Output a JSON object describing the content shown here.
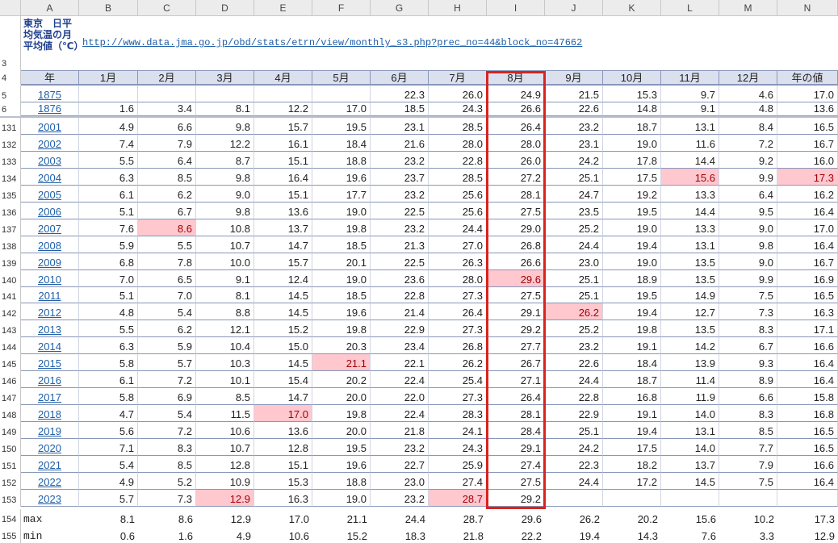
{
  "columns": [
    "A",
    "B",
    "C",
    "D",
    "E",
    "F",
    "G",
    "H",
    "I",
    "J",
    "K",
    "L",
    "M",
    "N"
  ],
  "title_cell": "東京　日平均気温の月平均値（℃）",
  "url": "http://www.data.jma.go.jp/obd/stats/etrn/view/monthly_s3.php?prec_no=44&block_no=47662",
  "header_row": [
    "年",
    "1月",
    "2月",
    "3月",
    "4月",
    "5月",
    "6月",
    "7月",
    "8月",
    "9月",
    "10月",
    "11月",
    "12月",
    "年の値"
  ],
  "top_rows": [
    {
      "row": "5",
      "year": "1875",
      "values": [
        "",
        "",
        "",
        "",
        "",
        "22.3",
        "26.0",
        "24.9",
        "21.5",
        "15.3",
        "9.7",
        "4.6",
        "17.0"
      ]
    },
    {
      "row": "6",
      "year": "1876",
      "values": [
        "1.6",
        "3.4",
        "8.1",
        "12.2",
        "17.0",
        "18.5",
        "24.3",
        "26.6",
        "22.6",
        "14.8",
        "9.1",
        "4.8",
        "13.6"
      ]
    }
  ],
  "rows": [
    {
      "row": "131",
      "year": "2001",
      "values": [
        "4.9",
        "6.6",
        "9.8",
        "15.7",
        "19.5",
        "23.1",
        "28.5",
        "26.4",
        "23.2",
        "18.7",
        "13.1",
        "8.4",
        "16.5"
      ]
    },
    {
      "row": "132",
      "year": "2002",
      "values": [
        "7.4",
        "7.9",
        "12.2",
        "16.1",
        "18.4",
        "21.6",
        "28.0",
        "28.0",
        "23.1",
        "19.0",
        "11.6",
        "7.2",
        "16.7"
      ]
    },
    {
      "row": "133",
      "year": "2003",
      "values": [
        "5.5",
        "6.4",
        "8.7",
        "15.1",
        "18.8",
        "23.2",
        "22.8",
        "26.0",
        "24.2",
        "17.8",
        "14.4",
        "9.2",
        "16.0"
      ]
    },
    {
      "row": "134",
      "year": "2004",
      "values": [
        "6.3",
        "8.5",
        "9.8",
        "16.4",
        "19.6",
        "23.7",
        "28.5",
        "27.2",
        "25.1",
        "17.5",
        "15.6",
        "9.9",
        "17.3"
      ]
    },
    {
      "row": "135",
      "year": "2005",
      "values": [
        "6.1",
        "6.2",
        "9.0",
        "15.1",
        "17.7",
        "23.2",
        "25.6",
        "28.1",
        "24.7",
        "19.2",
        "13.3",
        "6.4",
        "16.2"
      ]
    },
    {
      "row": "136",
      "year": "2006",
      "values": [
        "5.1",
        "6.7",
        "9.8",
        "13.6",
        "19.0",
        "22.5",
        "25.6",
        "27.5",
        "23.5",
        "19.5",
        "14.4",
        "9.5",
        "16.4"
      ]
    },
    {
      "row": "137",
      "year": "2007",
      "values": [
        "7.6",
        "8.6",
        "10.8",
        "13.7",
        "19.8",
        "23.2",
        "24.4",
        "29.0",
        "25.2",
        "19.0",
        "13.3",
        "9.0",
        "17.0"
      ]
    },
    {
      "row": "138",
      "year": "2008",
      "values": [
        "5.9",
        "5.5",
        "10.7",
        "14.7",
        "18.5",
        "21.3",
        "27.0",
        "26.8",
        "24.4",
        "19.4",
        "13.1",
        "9.8",
        "16.4"
      ]
    },
    {
      "row": "139",
      "year": "2009",
      "values": [
        "6.8",
        "7.8",
        "10.0",
        "15.7",
        "20.1",
        "22.5",
        "26.3",
        "26.6",
        "23.0",
        "19.0",
        "13.5",
        "9.0",
        "16.7"
      ]
    },
    {
      "row": "140",
      "year": "2010",
      "values": [
        "7.0",
        "6.5",
        "9.1",
        "12.4",
        "19.0",
        "23.6",
        "28.0",
        "29.6",
        "25.1",
        "18.9",
        "13.5",
        "9.9",
        "16.9"
      ]
    },
    {
      "row": "141",
      "year": "2011",
      "values": [
        "5.1",
        "7.0",
        "8.1",
        "14.5",
        "18.5",
        "22.8",
        "27.3",
        "27.5",
        "25.1",
        "19.5",
        "14.9",
        "7.5",
        "16.5"
      ]
    },
    {
      "row": "142",
      "year": "2012",
      "values": [
        "4.8",
        "5.4",
        "8.8",
        "14.5",
        "19.6",
        "21.4",
        "26.4",
        "29.1",
        "26.2",
        "19.4",
        "12.7",
        "7.3",
        "16.3"
      ]
    },
    {
      "row": "143",
      "year": "2013",
      "values": [
        "5.5",
        "6.2",
        "12.1",
        "15.2",
        "19.8",
        "22.9",
        "27.3",
        "29.2",
        "25.2",
        "19.8",
        "13.5",
        "8.3",
        "17.1"
      ]
    },
    {
      "row": "144",
      "year": "2014",
      "values": [
        "6.3",
        "5.9",
        "10.4",
        "15.0",
        "20.3",
        "23.4",
        "26.8",
        "27.7",
        "23.2",
        "19.1",
        "14.2",
        "6.7",
        "16.6"
      ]
    },
    {
      "row": "145",
      "year": "2015",
      "values": [
        "5.8",
        "5.7",
        "10.3",
        "14.5",
        "21.1",
        "22.1",
        "26.2",
        "26.7",
        "22.6",
        "18.4",
        "13.9",
        "9.3",
        "16.4"
      ]
    },
    {
      "row": "146",
      "year": "2016",
      "values": [
        "6.1",
        "7.2",
        "10.1",
        "15.4",
        "20.2",
        "22.4",
        "25.4",
        "27.1",
        "24.4",
        "18.7",
        "11.4",
        "8.9",
        "16.4"
      ]
    },
    {
      "row": "147",
      "year": "2017",
      "values": [
        "5.8",
        "6.9",
        "8.5",
        "14.7",
        "20.0",
        "22.0",
        "27.3",
        "26.4",
        "22.8",
        "16.8",
        "11.9",
        "6.6",
        "15.8"
      ]
    },
    {
      "row": "148",
      "year": "2018",
      "values": [
        "4.7",
        "5.4",
        "11.5",
        "17.0",
        "19.8",
        "22.4",
        "28.3",
        "28.1",
        "22.9",
        "19.1",
        "14.0",
        "8.3",
        "16.8"
      ]
    },
    {
      "row": "149",
      "year": "2019",
      "values": [
        "5.6",
        "7.2",
        "10.6",
        "13.6",
        "20.0",
        "21.8",
        "24.1",
        "28.4",
        "25.1",
        "19.4",
        "13.1",
        "8.5",
        "16.5"
      ]
    },
    {
      "row": "150",
      "year": "2020",
      "values": [
        "7.1",
        "8.3",
        "10.7",
        "12.8",
        "19.5",
        "23.2",
        "24.3",
        "29.1",
        "24.2",
        "17.5",
        "14.0",
        "7.7",
        "16.5"
      ]
    },
    {
      "row": "151",
      "year": "2021",
      "values": [
        "5.4",
        "8.5",
        "12.8",
        "15.1",
        "19.6",
        "22.7",
        "25.9",
        "27.4",
        "22.3",
        "18.2",
        "13.7",
        "7.9",
        "16.6"
      ]
    },
    {
      "row": "152",
      "year": "2022",
      "values": [
        "4.9",
        "5.2",
        "10.9",
        "15.3",
        "18.8",
        "23.0",
        "27.4",
        "27.5",
        "24.4",
        "17.2",
        "14.5",
        "7.5",
        "16.4"
      ]
    },
    {
      "row": "153",
      "year": "2023",
      "values": [
        "5.7",
        "7.3",
        "12.9",
        "16.3",
        "19.0",
        "23.2",
        "28.7",
        "29.2",
        "",
        "",
        "",
        "",
        ""
      ]
    }
  ],
  "stat_rows": [
    {
      "row": "154",
      "label": "max",
      "values": [
        "8.1",
        "8.6",
        "12.9",
        "17.0",
        "21.1",
        "24.4",
        "28.7",
        "29.6",
        "26.2",
        "20.2",
        "15.6",
        "10.2",
        "17.3"
      ]
    },
    {
      "row": "155",
      "label": "min",
      "values": [
        "0.6",
        "1.6",
        "4.9",
        "10.6",
        "15.2",
        "18.3",
        "21.8",
        "22.2",
        "19.4",
        "14.3",
        "7.6",
        "3.3",
        "12.9"
      ]
    }
  ],
  "highlight_colors": {
    "max_fill": "#ffc7ce",
    "max_text": "#9c0006",
    "selection_border": "#d9231e"
  },
  "highlights": [
    {
      "year": "2007",
      "col": 2
    },
    {
      "year": "2023",
      "col": 3
    },
    {
      "year": "2018",
      "col": 4
    },
    {
      "year": "2015",
      "col": 5
    },
    {
      "year": "2023",
      "col": 7
    },
    {
      "year": "2010",
      "col": 8
    },
    {
      "year": "2012",
      "col": 9
    },
    {
      "year": "2004",
      "col": 11
    },
    {
      "year": "2004",
      "col": 13
    }
  ],
  "selected_column": "8月"
}
